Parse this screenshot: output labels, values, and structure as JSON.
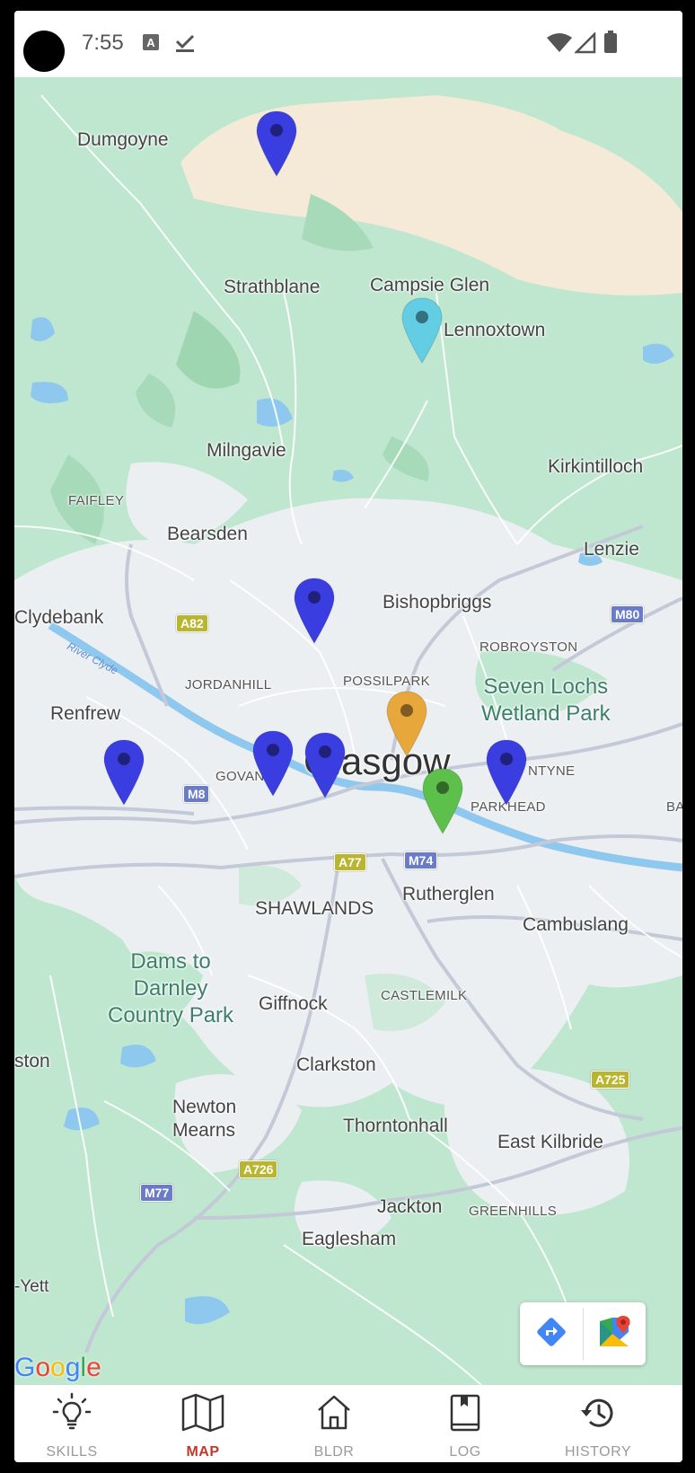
{
  "status_bar": {
    "time": "7:55"
  },
  "map": {
    "places": {
      "dumgoyne": "Dumgoyne",
      "strathblane": "Strathblane",
      "campsie_glen": "Campsie Glen",
      "lennoxtown": "Lennoxtown",
      "milngavie": "Milngavie",
      "kirkintilloch": "Kirkintilloch",
      "faifley": "FAIFLEY",
      "bearsden": "Bearsden",
      "lenzie": "Lenzie",
      "clydebank": "Clydebank",
      "bishopbriggs": "Bishopbriggs",
      "robroyston": "ROBROYSTON",
      "river_clyde": "River Clyde",
      "jordanhill": "JORDANHILL",
      "possilpark": "POSSILPARK",
      "seven_lochs_1": "Seven Lochs",
      "seven_lochs_2": "Wetland Park",
      "renfrew": "Renfrew",
      "govan": "GOVAN",
      "glasgow": "Glasgow",
      "dalmarnock": "NTYNE",
      "parkhead": "PARKHEAD",
      "edge_right": "BA",
      "shawlands": "SHAWLANDS",
      "rutherglen": "Rutherglen",
      "cambuslang": "Cambuslang",
      "dams_1": "Dams to",
      "dams_2": "Darnley",
      "dams_3": "Country Park",
      "giffnock": "Giffnock",
      "castlemilk": "CASTLEMILK",
      "ston": "ston",
      "clarkston": "Clarkston",
      "newton_mearns_1": "Newton",
      "newton_mearns_2": "Mearns",
      "thorntonhall": "Thorntonhall",
      "east_kilbride": "East Kilbride",
      "jackton": "Jackton",
      "greenhills": "GREENHILLS",
      "eaglesham": "Eaglesham",
      "yett": "-Yett"
    },
    "road_shields": {
      "a82": "A82",
      "m80": "M80",
      "m8": "M8",
      "a77": "A77",
      "m74": "M74",
      "a725": "A725",
      "a726": "A726",
      "m77": "M77"
    },
    "pins": [
      {
        "id": "dumgoyne-hills",
        "color": "#3a3de0"
      },
      {
        "id": "lennoxtown",
        "color": "#62cde3"
      },
      {
        "id": "maryhill",
        "color": "#3a3de0"
      },
      {
        "id": "renfrew",
        "color": "#3a3de0"
      },
      {
        "id": "govan",
        "color": "#3a3de0"
      },
      {
        "id": "glasgow-west",
        "color": "#3a3de0"
      },
      {
        "id": "city-centre",
        "color": "#e7a73a"
      },
      {
        "id": "gorbals",
        "color": "#5cc04a"
      },
      {
        "id": "parkhead",
        "color": "#3a3de0"
      }
    ],
    "attribution": "Google",
    "directions_icon": "directions-icon",
    "open_in_maps_icon": "google-maps-icon"
  },
  "nav": {
    "items": [
      {
        "label": "SKILLS",
        "icon": "lightbulb-icon"
      },
      {
        "label": "MAP",
        "icon": "map-icon"
      },
      {
        "label": "BLDR",
        "icon": "home-icon"
      },
      {
        "label": "LOG",
        "icon": "book-icon"
      },
      {
        "label": "HISTORY",
        "icon": "history-icon"
      }
    ],
    "active": "MAP",
    "active_color": "#c0392b"
  }
}
